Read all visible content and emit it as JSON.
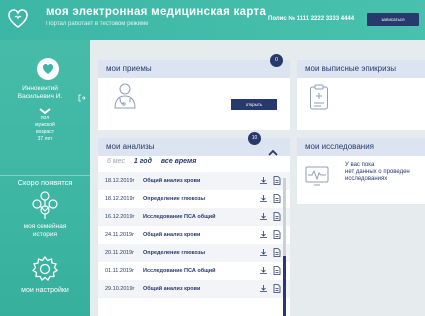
{
  "header": {
    "title": "моя электронная медицинская карта",
    "subtitle": "Портал работает в тестовом режиме",
    "policy": "Полис № 1111 2222 3333 4444",
    "signup_label": "записаться"
  },
  "sidebar": {
    "user_name_line1": "Иннокентий",
    "user_name_line2": "Васильевич И.",
    "gender_label": "пол",
    "gender_value": "мужской",
    "age_label": "возраст",
    "age_value": "37 лет",
    "coming_soon": "Скоро появятся",
    "family_history_line1": "моя семейная",
    "family_history_line2": "история",
    "settings": "мои настройки"
  },
  "appointments": {
    "title": "мои приемы",
    "count": "0",
    "open_label": "открыть"
  },
  "discharges": {
    "title": "мои выписные эпикризы"
  },
  "analyses": {
    "title": "мои анализы",
    "count": "10",
    "filters": [
      "6 мес",
      "1 год",
      "все время"
    ],
    "active_filter": "1 год",
    "rows": [
      {
        "date": "18.12.2019г",
        "name": "Общий анализ крови"
      },
      {
        "date": "18.12.2019г",
        "name": "Определение глюкозы"
      },
      {
        "date": "16.12.2019г",
        "name": "Исследование ПСА общий"
      },
      {
        "date": "24.11.2019г",
        "name": "Общий анализ крови"
      },
      {
        "date": "20.11.2019г",
        "name": "Определение глюкозы"
      },
      {
        "date": "01.11.2019г",
        "name": "Исследование ПСА общий"
      },
      {
        "date": "29.10.2019г",
        "name": "Общий анализ крови"
      }
    ]
  },
  "research": {
    "title": "мои исследования",
    "empty_line1": "У вас пока",
    "empty_line2": "нет данных о проведен",
    "empty_line3": "исследованиях"
  },
  "colors": {
    "teal": "#3cb6a6",
    "navy": "#283a6d",
    "panel_head": "#dde4f1"
  }
}
